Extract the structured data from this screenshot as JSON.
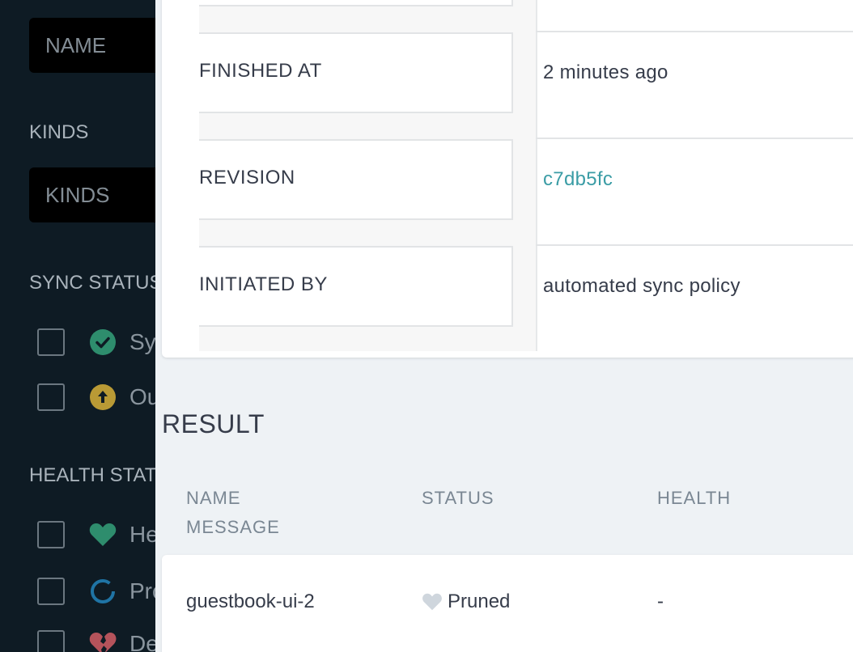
{
  "sidebar": {
    "name_placeholder": "NAME",
    "kinds_heading": "KINDS",
    "kinds_placeholder": "KINDS",
    "sync_heading": "SYNC STATUS",
    "sync_items": [
      {
        "label": "Synced",
        "icon": "check-circle-icon",
        "color": "#18be94"
      },
      {
        "label": "OutOfSync",
        "icon": "arrow-up-circle-icon",
        "color": "#f4c030"
      }
    ],
    "health_heading": "HEALTH STATUS",
    "health_items": [
      {
        "label": "Healthy",
        "icon": "heart-icon",
        "color": "#18be94"
      },
      {
        "label": "Progressing",
        "icon": "progress-ring-icon",
        "color": "#0dadea"
      },
      {
        "label": "Degraded",
        "icon": "broken-heart-icon",
        "color": "#e96d76"
      }
    ]
  },
  "operation": {
    "rows": [
      {
        "label": "FINISHED AT",
        "value": "2 minutes ago"
      },
      {
        "label": "REVISION",
        "value": "c7db5fc"
      },
      {
        "label": "INITIATED BY",
        "value": "automated sync policy"
      }
    ]
  },
  "result": {
    "title": "RESULT",
    "headers": {
      "name": "NAME",
      "status": "STATUS",
      "health": "HEALTH",
      "message": "MESSAGE"
    },
    "rows": [
      {
        "name": "guestbook-ui-2",
        "status": "Pruned",
        "health": "-"
      }
    ]
  },
  "colors": {
    "link": "#3a9ca5",
    "sidebar_bg": "#0e1b24",
    "main_bg": "#eef2f5"
  }
}
